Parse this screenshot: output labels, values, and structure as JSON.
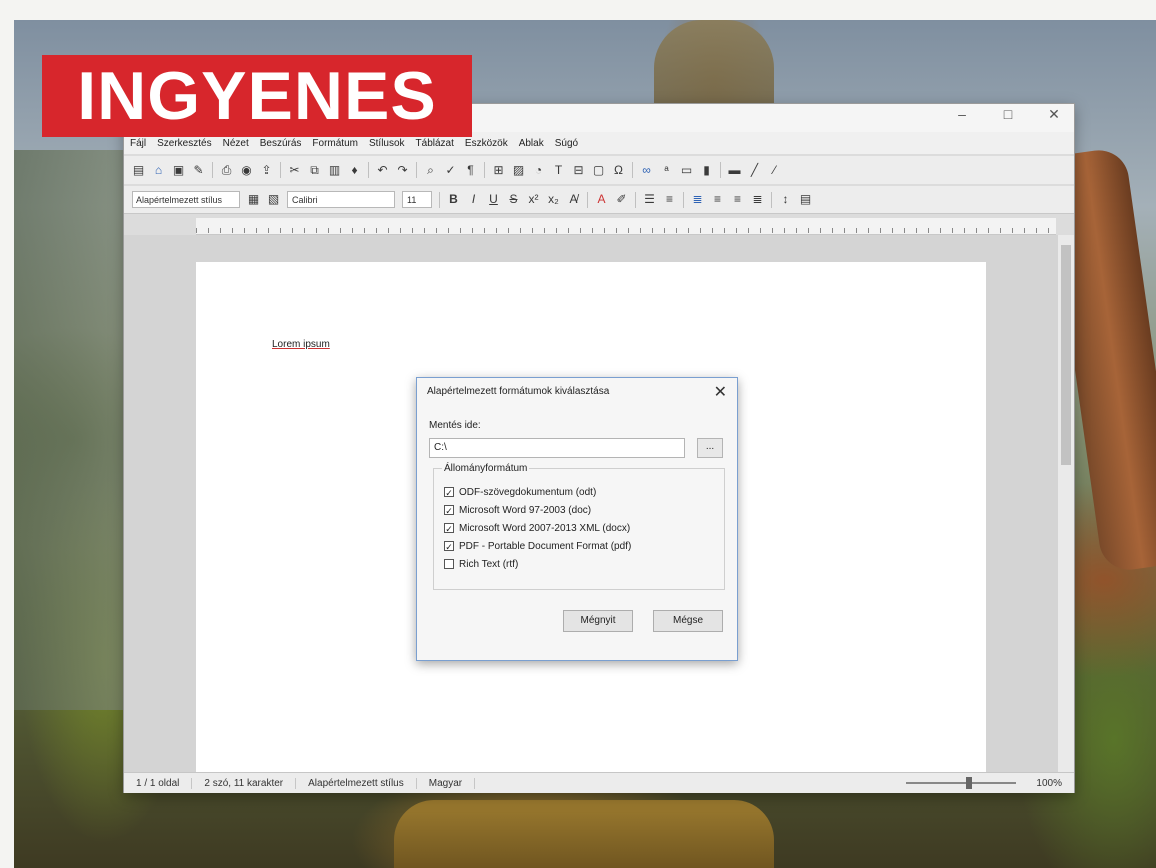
{
  "badge": {
    "text": "INGYENES"
  },
  "window": {
    "controls": {
      "minimize": "–",
      "maximize": "□",
      "close": "✕"
    },
    "menu": [
      "Fájl",
      "Szerkesztés",
      "Nézet",
      "Beszúrás",
      "Formátum",
      "Stílusok",
      "Táblázat",
      "Eszközök",
      "Ablak",
      "Súgó"
    ],
    "toolbar_format": {
      "paragraph_style": "Alapértelmezett stílus",
      "font_name": "Calibri",
      "font_size": "11"
    },
    "document": {
      "text": "Lorem ipsum"
    },
    "statusbar": {
      "page": "1 / 1 oldal",
      "words": "2 szó, 11 karakter",
      "style": "Alapértelmezett stílus",
      "language": "Magyar",
      "zoom": "100%"
    }
  },
  "dialog": {
    "title": "Alapértelmezett formátumok kiválasztása",
    "close": "✕",
    "folder_label": "Mentés ide:",
    "folder_value": "C:\\",
    "browse": "...",
    "group_title": "Állományformátum",
    "formats": [
      {
        "label": "ODF-szövegdokumentum (odt)",
        "checked": true
      },
      {
        "label": "Microsoft Word 97-2003 (doc)",
        "checked": true
      },
      {
        "label": "Microsoft Word 2007-2013 XML (docx)",
        "checked": true
      },
      {
        "label": "PDF - Portable Document Format (pdf)",
        "checked": true
      },
      {
        "label": "Rich Text (rtf)",
        "checked": false
      }
    ],
    "ok": "Mégnyit",
    "cancel": "Mégse"
  }
}
